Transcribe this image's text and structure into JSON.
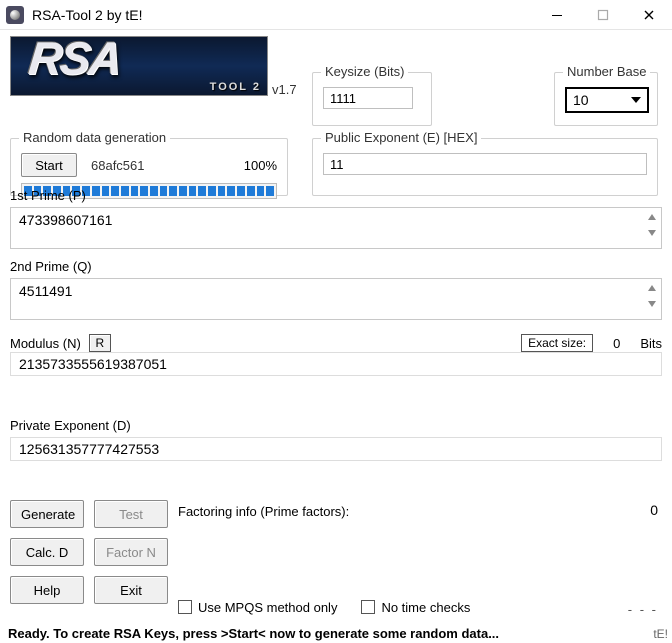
{
  "window": {
    "title": "RSA-Tool 2 by tE!"
  },
  "logo": {
    "big_text": "RSA",
    "small_text": "TOOL 2"
  },
  "version": "v1.7",
  "keysize": {
    "legend": "Keysize (Bits)",
    "value": "1111"
  },
  "numbase": {
    "legend": "Number Base",
    "value": "10"
  },
  "pubexp": {
    "legend": "Public Exponent (E) [HEX]",
    "value": "11"
  },
  "randgen": {
    "legend": "Random data generation",
    "start": "Start",
    "hash": "68afc561",
    "percent": "100%"
  },
  "prime_p": {
    "label": "1st Prime (P)",
    "value": "473398607161"
  },
  "prime_q": {
    "label": "2nd Prime (Q)",
    "value": "4511491"
  },
  "modulus": {
    "label": "Modulus (N)",
    "r_button": "R",
    "exact_label": "Exact size:",
    "exact_value": "0",
    "bits_label": "Bits",
    "value": "2135733555619387051"
  },
  "priv_d": {
    "label": "Private Exponent (D)",
    "value": "125631357777427553"
  },
  "buttons": {
    "generate": "Generate",
    "test": "Test",
    "calc_d": "Calc. D",
    "factor_n": "Factor N",
    "help": "Help",
    "exit": "Exit"
  },
  "factoring": {
    "label": "Factoring info (Prime factors):",
    "count": "0"
  },
  "checks": {
    "mpqs": "Use MPQS method only",
    "notime": "No time checks"
  },
  "dots": "- - -",
  "status": "Ready. To create RSA Keys, press >Start< now to generate some random data...",
  "corner": "tE!"
}
